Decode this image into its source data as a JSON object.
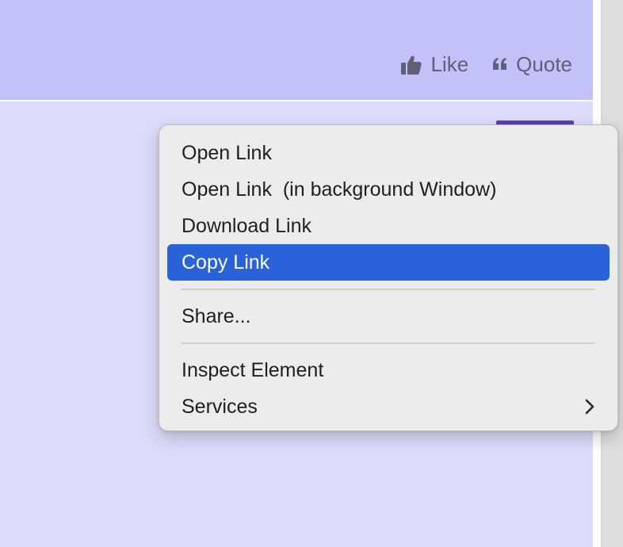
{
  "post_actions": {
    "like_label": "Like",
    "quote_label": "Quote",
    "like_icon": "thumbs-up-icon",
    "quote_icon": "quote-icon"
  },
  "context_menu": {
    "items": [
      {
        "label": "Open Link"
      },
      {
        "label": "Open Link  (in background Window)"
      },
      {
        "label": "Download Link"
      },
      {
        "label": "Copy Link",
        "selected": true
      },
      {
        "label": "Share..."
      },
      {
        "label": "Inspect Element"
      },
      {
        "label": "Services",
        "submenu_icon": "chevron-right-icon"
      }
    ]
  },
  "colors": {
    "post_header": "#c2c2f8",
    "post_body": "#dcdcfa",
    "menu_background": "#ececec",
    "menu_highlight": "#2a62d9",
    "accent_button": "#5b3fa8",
    "action_text": "#5f5f7a"
  }
}
